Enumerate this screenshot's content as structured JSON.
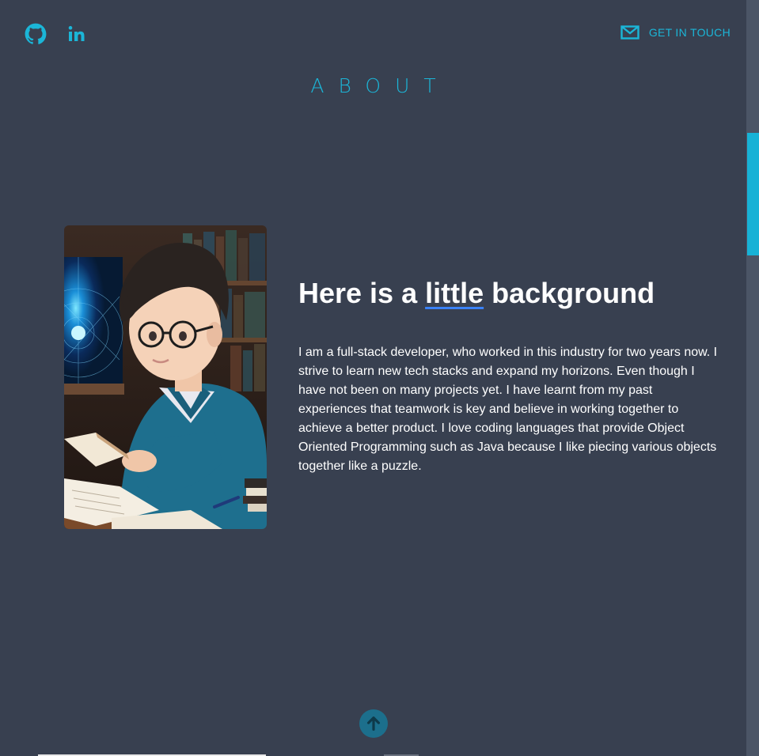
{
  "header": {
    "social_icons": [
      "github-icon",
      "linkedin-icon"
    ],
    "contact_label": "GET IN TOUCH",
    "contact_icon": "mail-icon"
  },
  "section": {
    "title": "ABOUT"
  },
  "about": {
    "headline_prefix": "Here is a ",
    "headline_highlight": "little",
    "headline_suffix": " background",
    "bio": "I am a full-stack developer, who worked in this industry for two years now. I strive to learn new tech stacks and expand my horizons. Even though I have not been on many projects yet. I have learnt from my past experiences that teamwork is key and believe in working together to achieve a better product. I love coding languages that provide Object Oriented Programming such as Java because I like piecing various objects together like a puzzle.",
    "image_icon": "portrait-illustration"
  },
  "footer": {
    "scroll_top_icon": "arrow-up-icon"
  },
  "colors": {
    "background": "#384050",
    "accent": "#1bb6d8",
    "underline": "#3b82f6",
    "scroll_button": "#1c6f8c"
  }
}
